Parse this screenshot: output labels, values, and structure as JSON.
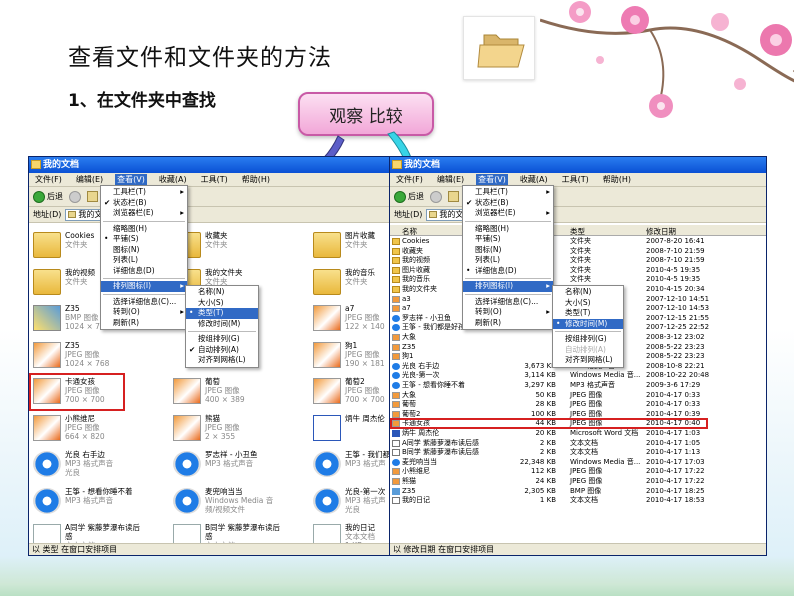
{
  "slide": {
    "title": "查看文件和文件夹的方法",
    "subtitle": "1、在文件夹中查找",
    "callout": "观察 比较"
  },
  "colors": {
    "accent": "#c85aa6",
    "title_bar": "#0a50d4",
    "highlight": "#d62020",
    "menu_select": "#316ac5"
  },
  "left_window": {
    "title": "我的文档",
    "menu": [
      "文件(F)",
      "编辑(E)",
      "查看(V)",
      "收藏(A)",
      "工具(T)",
      "帮助(H)"
    ],
    "active_menu": "查看(V)",
    "back_label": "后退",
    "address_label": "地址(D)",
    "address_value": "我的文",
    "status": "以 类型 在窗口安排项目",
    "tiles": [
      {
        "name": "Cookies",
        "sub1": "文件夹",
        "sub2": "",
        "icon": "folder-icon"
      },
      {
        "name": "收藏夹",
        "sub1": "文件夹",
        "sub2": "",
        "icon": "folder-icon"
      },
      {
        "name": "图片收藏",
        "sub1": "文件夹",
        "sub2": "",
        "icon": "folder-icon"
      },
      {
        "name": "我的视频",
        "sub1": "文件夹",
        "sub2": "",
        "icon": "folder-icon"
      },
      {
        "name": "我的文件夹",
        "sub1": "文件夹",
        "sub2": "",
        "icon": "folder-icon"
      },
      {
        "name": "我的音乐",
        "sub1": "文件夹",
        "sub2": "",
        "icon": "folder-icon"
      },
      {
        "name": "Z35",
        "sub1": "BMP 图像",
        "sub2": "1024 × 768",
        "icon": "bmp-icon"
      },
      {
        "name": "",
        "sub1": "",
        "sub2": "",
        "icon": "none"
      },
      {
        "name": "a7",
        "sub1": "JPEG 图像",
        "sub2": "122 × 140",
        "icon": "image-icon"
      },
      {
        "name": "Z35",
        "sub1": "JPEG 图像",
        "sub2": "1024 × 768",
        "icon": "image-icon"
      },
      {
        "name": "",
        "sub1": "",
        "sub2": "",
        "icon": "none"
      },
      {
        "name": "狗1",
        "sub1": "JPEG 图像",
        "sub2": "190 × 181",
        "icon": "image-icon"
      },
      {
        "name": "卡通女孩",
        "sub1": "JPEG 图像",
        "sub2": "700 × 700",
        "icon": "image-icon"
      },
      {
        "name": "葡萄",
        "sub1": "JPEG 图像",
        "sub2": "400 × 389",
        "icon": "image-icon"
      },
      {
        "name": "葡萄2",
        "sub1": "JPEG 图像",
        "sub2": "700 × 700",
        "icon": "image-icon"
      },
      {
        "name": "小熊维尼",
        "sub1": "JPEG 图像",
        "sub2": "664 × 820",
        "icon": "image-icon"
      },
      {
        "name": "熊猫",
        "sub1": "JPEG 图像",
        "sub2": "2 × 355",
        "icon": "image-icon"
      },
      {
        "name": "炳牛 周杰伦",
        "sub1": "",
        "sub2": "",
        "icon": "word-icon"
      },
      {
        "name": "光良 右手边",
        "sub1": "MP3 格式声音",
        "sub2": "光良",
        "icon": "media-icon"
      },
      {
        "name": "罗志祥 - 小丑鱼",
        "sub1": "MP3 格式声音",
        "sub2": "",
        "icon": "media-icon"
      },
      {
        "name": "王筝 - 我们都",
        "sub1": "MP3 格式声",
        "sub2": "",
        "icon": "media-icon"
      },
      {
        "name": "王筝 - 想看你睡不着",
        "sub1": "MP3 格式声音",
        "sub2": "",
        "icon": "media-icon"
      },
      {
        "name": "麦兜响当当",
        "sub1": "Windows Media 音频/视频文件",
        "sub2": "",
        "icon": "media-icon"
      },
      {
        "name": "光良-第一次",
        "sub1": "MP3 格式声",
        "sub2": "光良",
        "icon": "media-icon"
      },
      {
        "name": "A同学 紫藤萝瀑布读后感",
        "sub1": "文本文档",
        "sub2": "1 KB",
        "icon": "doc-icon"
      },
      {
        "name": "B同学 紫藤萝瀑布读后感",
        "sub1": "文本文档",
        "sub2": "1 KB",
        "icon": "doc-icon"
      },
      {
        "name": "我的日记",
        "sub1": "文本文档",
        "sub2": "1 KB",
        "icon": "doc-icon"
      }
    ],
    "view_menu": [
      {
        "label": "工具栏(T)",
        "mark": "",
        "arrow": true
      },
      {
        "label": "状态栏(B)",
        "mark": "✔",
        "arrow": false
      },
      {
        "label": "浏览器栏(E)",
        "mark": "",
        "arrow": true
      },
      {
        "sep": true
      },
      {
        "label": "缩略图(H)",
        "mark": "",
        "arrow": false
      },
      {
        "label": "平铺(S)",
        "mark": "•",
        "arrow": false
      },
      {
        "label": "图标(N)",
        "mark": "",
        "arrow": false
      },
      {
        "label": "列表(L)",
        "mark": "",
        "arrow": false
      },
      {
        "label": "详细信息(D)",
        "mark": "",
        "arrow": false
      },
      {
        "sep": true
      },
      {
        "label": "排列图标(I)",
        "mark": "",
        "arrow": true,
        "selected": true
      },
      {
        "sep": true
      },
      {
        "label": "选择详细信息(C)...",
        "mark": "",
        "arrow": false
      },
      {
        "label": "转到(O)",
        "mark": "",
        "arrow": true
      },
      {
        "label": "刷新(R)",
        "mark": "",
        "arrow": false
      }
    ],
    "arrange_menu": [
      {
        "label": "名称(N)",
        "mark": ""
      },
      {
        "label": "大小(S)",
        "mark": ""
      },
      {
        "label": "类型(T)",
        "mark": "•",
        "selected": true
      },
      {
        "label": "修改时间(M)",
        "mark": ""
      },
      {
        "sep": true
      },
      {
        "label": "按组排列(G)",
        "mark": ""
      },
      {
        "label": "自动排列(A)",
        "mark": "✔"
      },
      {
        "label": "对齐到网格(L)",
        "mark": ""
      }
    ]
  },
  "right_window": {
    "title": "我的文档",
    "menu": [
      "文件(F)",
      "编辑(E)",
      "查看(V)",
      "收藏(A)",
      "工具(T)",
      "帮助(H)"
    ],
    "active_menu": "查看(V)",
    "back_label": "后退",
    "address_label": "地址(D)",
    "address_value": "我的文档",
    "status": "以 修改日期 在窗口安排项目",
    "headers": {
      "name": "名称",
      "size": "大小",
      "type": "类型",
      "date": "修改日期"
    },
    "rows": [
      {
        "name": "Cookies",
        "size": "",
        "type": "文件夹",
        "date": "2007-8-20 16:41",
        "icon": "folder"
      },
      {
        "name": "收藏夹",
        "size": "",
        "type": "文件夹",
        "date": "2008-7-10 21:59",
        "icon": "folder"
      },
      {
        "name": "我的视频",
        "size": "",
        "type": "文件夹",
        "date": "2008-7-10 21:59",
        "icon": "folder"
      },
      {
        "name": "图片收藏",
        "size": "",
        "type": "文件夹",
        "date": "2010-4-5 19:35",
        "icon": "folder"
      },
      {
        "name": "我的音乐",
        "size": "",
        "type": "文件夹",
        "date": "2010-4-5 19:35",
        "icon": "folder"
      },
      {
        "name": "我的文件夹",
        "size": "",
        "type": "文件夹",
        "date": "2010-4-15 20:34",
        "icon": "folder"
      },
      {
        "name": "a3",
        "size": "",
        "type": "JPEG 图像",
        "date": "2007-12-10 14:51",
        "icon": "img"
      },
      {
        "name": "a7",
        "size": "",
        "type": "JPEG 图像",
        "date": "2007-12-10 14:53",
        "icon": "img"
      },
      {
        "name": "罗志祥 - 小丑鱼",
        "size": "",
        "type": "MP3 格式声音",
        "date": "2007-12-15 21:55",
        "icon": "media"
      },
      {
        "name": "王筝 - 我们都是好孩子",
        "size": "3,7",
        "type": "MP3 格式声音",
        "date": "2007-12-25 22:52",
        "icon": "media"
      },
      {
        "name": "大象",
        "size": "",
        "type": "JPEG 图像",
        "date": "2008-3-12 23:02",
        "icon": "img"
      },
      {
        "name": "Z35",
        "size": "",
        "type": "JPEG 图像",
        "date": "2008-5-22 23:23",
        "icon": "img"
      },
      {
        "name": "狗1",
        "size": "",
        "type": "JPEG 图像",
        "date": "2008-5-22 23:23",
        "icon": "img"
      },
      {
        "name": "光良 右手边",
        "size": "3,673 KB",
        "type": "MP3 格式声音",
        "date": "2008-10-8 22:21",
        "icon": "media"
      },
      {
        "name": "光良-第一次",
        "size": "3,114 KB",
        "type": "Windows Media 音...",
        "date": "2008-10-22 20:48",
        "icon": "media"
      },
      {
        "name": "王筝 - 想看你睡不着",
        "size": "3,297 KB",
        "type": "MP3 格式声音",
        "date": "2009-3-6 17:29",
        "icon": "media"
      },
      {
        "name": "大象",
        "size": "50 KB",
        "type": "JPEG 图像",
        "date": "2010-4-17 0:33",
        "icon": "img"
      },
      {
        "name": "葡萄",
        "size": "28 KB",
        "type": "JPEG 图像",
        "date": "2010-4-17 0:33",
        "icon": "img"
      },
      {
        "name": "葡萄2",
        "size": "100 KB",
        "type": "JPEG 图像",
        "date": "2010-4-17 0:39",
        "icon": "img"
      },
      {
        "name": "卡通女孩",
        "size": "44 KB",
        "type": "JPEG 图像",
        "date": "2010-4-17 0:40",
        "icon": "img",
        "highlight": true
      },
      {
        "name": "炳牛 周杰伦",
        "size": "20 KB",
        "type": "Microsoft Word 文档",
        "date": "2010-4-17 1:03",
        "icon": "word"
      },
      {
        "name": "A同学 紫藤萝瀑布读后感",
        "size": "2 KB",
        "type": "文本文档",
        "date": "2010-4-17 1:05",
        "icon": "doc"
      },
      {
        "name": "B同学 紫藤萝瀑布读后感",
        "size": "2 KB",
        "type": "文本文档",
        "date": "2010-4-17 1:13",
        "icon": "doc"
      },
      {
        "name": "麦兜响当当",
        "size": "22,348 KB",
        "type": "Windows Media 音...",
        "date": "2010-4-17 17:03",
        "icon": "media"
      },
      {
        "name": "小熊维尼",
        "size": "112 KB",
        "type": "JPEG 图像",
        "date": "2010-4-17 17:22",
        "icon": "img"
      },
      {
        "name": "熊猫",
        "size": "24 KB",
        "type": "JPEG 图像",
        "date": "2010-4-17 17:22",
        "icon": "img"
      },
      {
        "name": "Z35",
        "size": "2,305 KB",
        "type": "BMP 图像",
        "date": "2010-4-17 18:25",
        "icon": "bmp"
      },
      {
        "name": "我的日记",
        "size": "1 KB",
        "type": "文本文档",
        "date": "2010-4-17 18:53",
        "icon": "doc"
      }
    ],
    "view_menu": [
      {
        "label": "工具栏(T)",
        "mark": "",
        "arrow": true
      },
      {
        "label": "状态栏(B)",
        "mark": "✔",
        "arrow": false
      },
      {
        "label": "浏览器栏(E)",
        "mark": "",
        "arrow": true
      },
      {
        "sep": true
      },
      {
        "label": "缩略图(H)",
        "mark": "",
        "arrow": false
      },
      {
        "label": "平铺(S)",
        "mark": "",
        "arrow": false
      },
      {
        "label": "图标(N)",
        "mark": "",
        "arrow": false
      },
      {
        "label": "列表(L)",
        "mark": "",
        "arrow": false
      },
      {
        "label": "详细信息(D)",
        "mark": "•",
        "arrow": false
      },
      {
        "sep": true
      },
      {
        "label": "排列图标(I)",
        "mark": "",
        "arrow": true,
        "selected": true
      },
      {
        "sep": true
      },
      {
        "label": "选择详细信息(C)...",
        "mark": "",
        "arrow": false
      },
      {
        "label": "转到(O)",
        "mark": "",
        "arrow": true
      },
      {
        "label": "刷新(R)",
        "mark": "",
        "arrow": false
      }
    ],
    "arrange_menu": [
      {
        "label": "名称(N)",
        "mark": ""
      },
      {
        "label": "大小(S)",
        "mark": ""
      },
      {
        "label": "类型(T)",
        "mark": ""
      },
      {
        "label": "修改时间(M)",
        "mark": "•",
        "selected": true
      },
      {
        "sep": true
      },
      {
        "label": "按组排列(G)",
        "mark": ""
      },
      {
        "label": "自动排列(A)",
        "mark": "",
        "disabled": true
      },
      {
        "label": "对齐到网格(L)",
        "mark": ""
      }
    ]
  }
}
